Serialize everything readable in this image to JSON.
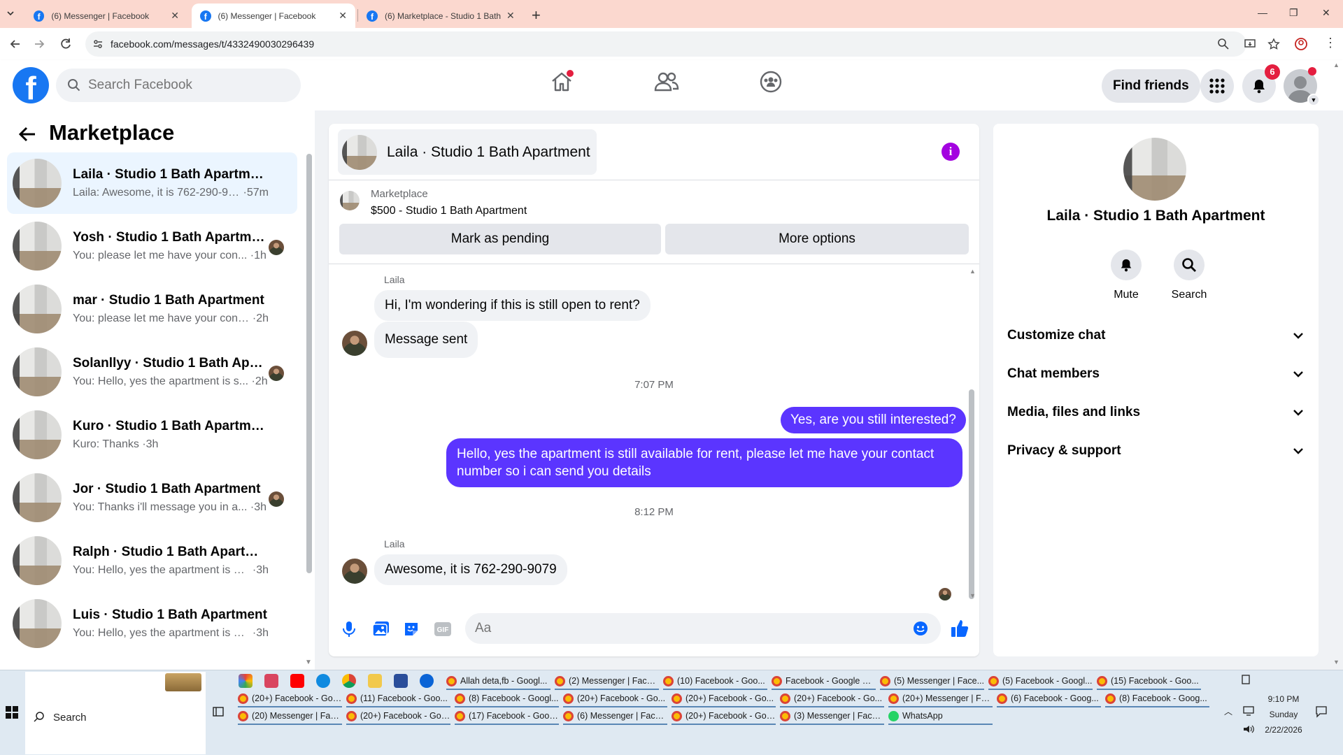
{
  "browser": {
    "tabs": [
      {
        "title": "(6) Messenger | Facebook",
        "active": false
      },
      {
        "title": "(6) Messenger | Facebook",
        "active": true
      },
      {
        "title": "(6) Marketplace - Studio 1 Bath",
        "active": false
      }
    ],
    "url": "facebook.com/messages/t/4332490030296439"
  },
  "fb_header": {
    "logo_letter": "f",
    "search_placeholder": "Search Facebook",
    "find_friends": "Find friends",
    "notification_count": "6",
    "brand_color": "#1877f2"
  },
  "sidebar": {
    "title": "Marketplace",
    "conversations": [
      {
        "name": "Laila · Studio 1 Bath Apartment",
        "preview": "Laila: Awesome, it is 762-290-9079",
        "time": "57m",
        "selected": true
      },
      {
        "name": "Yosh · Studio 1 Bath Apartment",
        "preview": "You: please let me have your con...",
        "time": "1h",
        "selected": false
      },
      {
        "name": "mar · Studio 1 Bath Apartment",
        "preview": "You: please let me have your contac...",
        "time": "2h",
        "selected": false
      },
      {
        "name": "Solanllyy · Studio 1 Bath Apart...",
        "preview": "You: Hello, yes the apartment is s...",
        "time": "2h",
        "selected": false
      },
      {
        "name": "Kuro · Studio 1 Bath Apartment",
        "preview": "Kuro: Thanks",
        "time": "3h",
        "selected": false
      },
      {
        "name": "Jor · Studio 1 Bath Apartment",
        "preview": "You: Thanks i'll message you in a...",
        "time": "3h",
        "selected": false
      },
      {
        "name": "Ralph · Studio 1 Bath Apartment",
        "preview": "You: Hello, yes the apartment is still ...",
        "time": "3h",
        "selected": false
      },
      {
        "name": "Luis · Studio 1 Bath Apartment",
        "preview": "You: Hello, yes the apartment is still ...",
        "time": "3h",
        "selected": false
      }
    ]
  },
  "chat": {
    "title": "Laila · Studio 1 Bath Apartment",
    "marketplace_label": "Marketplace",
    "listing": "$500 - Studio 1 Bath Apartment",
    "mark_pending": "Mark as pending",
    "more_options": "More options",
    "messages": {
      "sender1": "Laila",
      "m1": "Hi, I'm wondering if this is still open to rent?",
      "m2": "Message sent",
      "time1": "7:07 PM",
      "m3": "Yes, are you still interested?",
      "m4": "Hello, yes the apartment is still available for rent, please  let me have your contact number so i can send you details",
      "time2": "8:12 PM",
      "sender2": "Laila",
      "m5": "Awesome, it is 762-290-9079"
    },
    "composer_placeholder": "Aa",
    "outgoing_color": "#5b35ff"
  },
  "info_panel": {
    "name": "Laila · Studio 1 Bath Apartment",
    "mute": "Mute",
    "search": "Search",
    "sections": [
      "Customize chat",
      "Chat members",
      "Media, files and links",
      "Privacy & support"
    ]
  },
  "taskbar": {
    "search": "Search",
    "items_row1": [
      "Allah deta,fb - Googl...",
      "(2) Messenger | Faceb...",
      "(10) Facebook - Goo...",
      "Facebook - Google C...",
      "(5) Messenger | Face...",
      "(5) Facebook - Googl...",
      "(15) Facebook - Goo..."
    ],
    "items_row2": [
      "(20+) Facebook - Goo...",
      "(11) Facebook - Goo...",
      "(8) Facebook - Googl...",
      "(20+) Facebook - Go...",
      "(20+) Facebook - Go...",
      "(20+) Facebook - Go...",
      "(20+) Messenger | Fa...",
      "(6) Facebook - Goog...",
      "(8) Facebook - Goog..."
    ],
    "items_row3": [
      "(20) Messenger | Face...",
      "(20+) Facebook - Goo...",
      "(17) Facebook - Goog...",
      "(6) Messenger | Faceb...",
      "(20+) Facebook - Goo...",
      "(3) Messenger | Faceb...",
      "WhatsApp"
    ],
    "time": "9:10 PM",
    "day": "Sunday",
    "date": "2/22/2026"
  }
}
